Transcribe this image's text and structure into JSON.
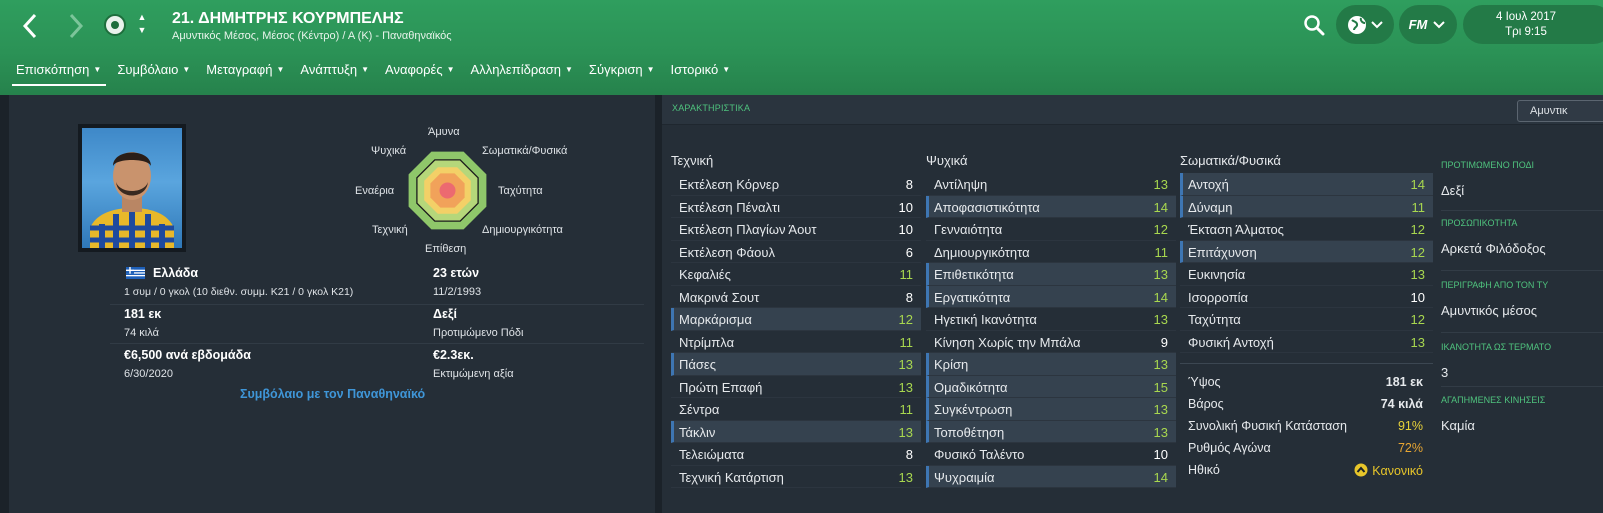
{
  "header": {
    "title": "21. ΔΗΜΗΤΡΗΣ ΚΟΥΡΜΠΕΛΗΣ",
    "subtitle": "Αμυντικός Μέσος, Μέσος (Κέντρο) / Α (Κ) - Παναθηναϊκός",
    "date": "4 Ιουλ 2017",
    "time": "Τρι 9:15",
    "fm_label": "FM",
    "accent": "#2f9e5e"
  },
  "menu": [
    {
      "label": "Επισκόπηση"
    },
    {
      "label": "Συμβόλαιο"
    },
    {
      "label": "Μεταγραφή"
    },
    {
      "label": "Ανάπτυξη"
    },
    {
      "label": "Αναφορές"
    },
    {
      "label": "Αλληλεπίδραση"
    },
    {
      "label": "Σύγκριση"
    },
    {
      "label": "Ιστορικό"
    }
  ],
  "radar": {
    "labels": {
      "top": "Άμυνα",
      "top_right": "Σωματικά/Φυσικά",
      "right": "Ταχύτητα",
      "bottom_right": "Δημιουργικότητα",
      "bottom": "Επίθεση",
      "bottom_left": "Τεχνική",
      "left": "Εναέρια",
      "top_left": "Ψυχικά"
    }
  },
  "profile": {
    "nationality": "Ελλάδα",
    "caps": "1 συμ / 0 γκολ (10 διεθν. συμμ. Κ21 / 0 γκολ Κ21)",
    "age": "23 ετών",
    "dob": "11/2/1993",
    "height": "181 εκ",
    "weight": "74 κιλά",
    "foot": "Δεξί",
    "foot_label": "Προτιμώμενο Πόδι",
    "wage": "€6,500 ανά εβδομάδα",
    "contract_end": "6/30/2020",
    "value": "€2.3εκ.",
    "value_label": "Εκτιμώμενη αξία",
    "contract_link": "Συμβόλαιο με τον Παναθηναϊκό"
  },
  "attributes": {
    "section_title": "ΧΑΡΑΚΤΗΡΙΣΤΙΚΑ",
    "dropdown": "Αμυντικ",
    "technical": {
      "title": "Τεχνική",
      "items": [
        {
          "name": "Εκτέλεση Κόρνερ",
          "value": "8",
          "hl": false
        },
        {
          "name": "Εκτέλεση Πέναλτι",
          "value": "10",
          "hl": false
        },
        {
          "name": "Εκτέλεση Πλαγίων Άουτ",
          "value": "10",
          "hl": false
        },
        {
          "name": "Εκτέλεση Φάουλ",
          "value": "6",
          "hl": false
        },
        {
          "name": "Κεφαλιές",
          "value": "11",
          "hl": false
        },
        {
          "name": "Μακρινά Σουτ",
          "value": "8",
          "hl": false
        },
        {
          "name": "Μαρκάρισμα",
          "value": "12",
          "hl": true
        },
        {
          "name": "Ντρίμπλα",
          "value": "11",
          "hl": false
        },
        {
          "name": "Πάσες",
          "value": "13",
          "hl": true
        },
        {
          "name": "Πρώτη Επαφή",
          "value": "13",
          "hl": false
        },
        {
          "name": "Σέντρα",
          "value": "11",
          "hl": false
        },
        {
          "name": "Τάκλιν",
          "value": "13",
          "hl": true
        },
        {
          "name": "Τελειώματα",
          "value": "8",
          "hl": false
        },
        {
          "name": "Τεχνική Κατάρτιση",
          "value": "13",
          "hl": false
        }
      ]
    },
    "mental": {
      "title": "Ψυχικά",
      "items": [
        {
          "name": "Αντίληψη",
          "value": "13",
          "hl": false
        },
        {
          "name": "Αποφασιστικότητα",
          "value": "14",
          "hl": true
        },
        {
          "name": "Γενναιότητα",
          "value": "12",
          "hl": false
        },
        {
          "name": "Δημιουργικότητα",
          "value": "11",
          "hl": false
        },
        {
          "name": "Επιθετικότητα",
          "value": "13",
          "hl": true
        },
        {
          "name": "Εργατικότητα",
          "value": "14",
          "hl": true
        },
        {
          "name": "Ηγετική Ικανότητα",
          "value": "13",
          "hl": false
        },
        {
          "name": "Κίνηση Χωρίς την Μπάλα",
          "value": "9",
          "hl": false
        },
        {
          "name": "Κρίση",
          "value": "13",
          "hl": true
        },
        {
          "name": "Ομαδικότητα",
          "value": "15",
          "hl": true
        },
        {
          "name": "Συγκέντρωση",
          "value": "13",
          "hl": true
        },
        {
          "name": "Τοποθέτηση",
          "value": "13",
          "hl": true
        },
        {
          "name": "Φυσικό Ταλέντο",
          "value": "10",
          "hl": false
        },
        {
          "name": "Ψυχραιμία",
          "value": "14",
          "hl": true
        }
      ]
    },
    "physical": {
      "title": "Σωματικά/Φυσικά",
      "items": [
        {
          "name": "Αντοχή",
          "value": "14",
          "hl": true
        },
        {
          "name": "Δύναμη",
          "value": "11",
          "hl": true
        },
        {
          "name": "Έκταση Άλματος",
          "value": "12",
          "hl": false
        },
        {
          "name": "Επιτάχυνση",
          "value": "12",
          "hl": true
        },
        {
          "name": "Ευκινησία",
          "value": "13",
          "hl": false
        },
        {
          "name": "Ισορροπία",
          "value": "10",
          "hl": false
        },
        {
          "name": "Ταχύτητα",
          "value": "12",
          "hl": false
        },
        {
          "name": "Φυσική Αντοχή",
          "value": "13",
          "hl": false
        }
      ]
    },
    "physical_info": [
      {
        "name": "Ύψος",
        "value": "181 εκ",
        "color": "#ffffff"
      },
      {
        "name": "Βάρος",
        "value": "74 κιλά",
        "color": "#ffffff"
      },
      {
        "name": "Συνολική Φυσική Κατάσταση",
        "value": "91%",
        "color": "#e8d23a"
      },
      {
        "name": "Ρυθμός Αγώνα",
        "value": "72%",
        "color": "#e8a632"
      },
      {
        "name": "Ηθικό",
        "value": "Κανονικό",
        "color": "#e8c62a"
      }
    ]
  },
  "side": [
    {
      "title": "ΠΡΟΤΙΜΩΜΕΝΟ ΠΟΔΙ",
      "value": "Δεξί"
    },
    {
      "title": "ΠΡΟΣΩΠΙΚΟΤΗΤΑ",
      "value": "Αρκετά Φιλόδοξος"
    },
    {
      "title": "ΠΕΡΙΓΡΑΦΗ ΑΠΟ ΤΟΝ ΤΥ",
      "value": "Αμυντικός μέσος"
    },
    {
      "title": "ΙΚΑΝΟΤΗΤΑ ΩΣ ΤΕΡΜΑΤΟ",
      "value": "3"
    },
    {
      "title": "ΑΓΑΠΗΜΕΝΕΣ ΚΙΝΗΣΕΙΣ",
      "value": "Καμία"
    }
  ]
}
